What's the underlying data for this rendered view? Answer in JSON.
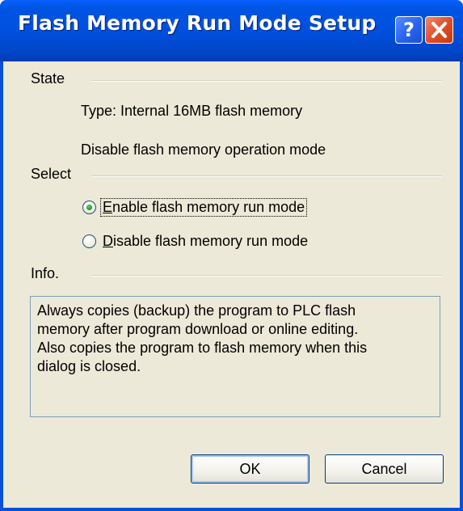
{
  "window": {
    "title": "Flash Memory Run Mode Setup",
    "help_glyph": "?",
    "close_icon": "close-icon"
  },
  "state": {
    "label": "State",
    "type_text": "Type: Internal 16MB flash memory",
    "mode_text": "Disable flash memory operation mode"
  },
  "select": {
    "label": "Select",
    "options": [
      {
        "label_first": "E",
        "label_rest": "nable flash memory run mode",
        "selected": true
      },
      {
        "label_first": "D",
        "label_rest": "isable flash memory run mode",
        "selected": false
      }
    ]
  },
  "info": {
    "label": "Info.",
    "lines": [
      "Always copies (backup) the program to PLC flash",
      "memory after program download or online editing.",
      "Also copies the program to flash memory when this",
      "dialog is closed."
    ]
  },
  "buttons": {
    "ok_label": "OK",
    "cancel_label": "Cancel"
  },
  "colors": {
    "title_bar": "#0054e3",
    "close_button": "#e0502a",
    "dialog_face": "#ece9d8",
    "radio_selected": "#21a121"
  }
}
